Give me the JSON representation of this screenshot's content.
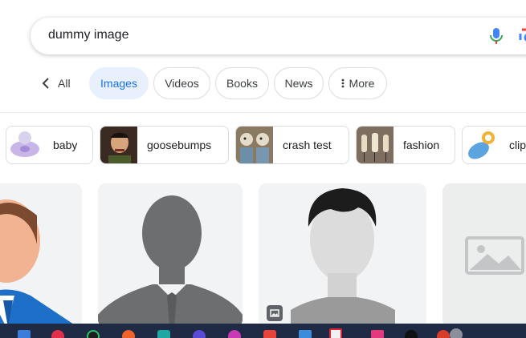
{
  "search": {
    "query": "dummy image"
  },
  "tabs": {
    "back_label": "All",
    "items": [
      {
        "label": "Images"
      },
      {
        "label": "Videos"
      },
      {
        "label": "Books"
      },
      {
        "label": "News"
      },
      {
        "label": "More"
      }
    ]
  },
  "chips": [
    {
      "label": "baby"
    },
    {
      "label": "goosebumps"
    },
    {
      "label": "crash test"
    },
    {
      "label": "fashion"
    },
    {
      "label": "clip"
    }
  ],
  "colors": {
    "accent": "#1a73e8",
    "active_tab_bg": "#e8f0fe",
    "card_bg": "#f1f3f4",
    "silhouette": "#6d6e70",
    "taskbar": "#1f2a44"
  }
}
